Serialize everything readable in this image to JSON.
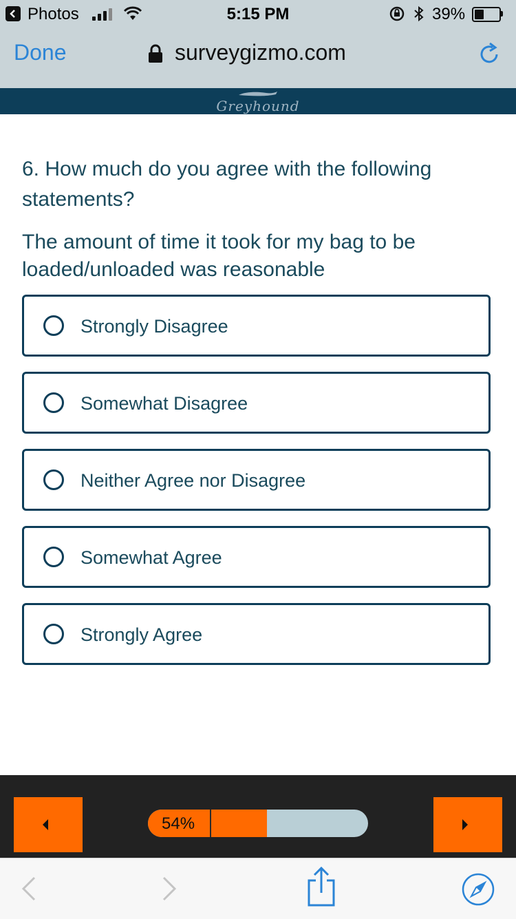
{
  "status_bar": {
    "back_app": "Photos",
    "time": "5:15 PM",
    "battery_percent": "39%",
    "battery_level": 0.39
  },
  "browser": {
    "done_label": "Done",
    "url": "surveygizmo.com"
  },
  "brand": {
    "logo_text": "Greyhound",
    "color": "#0d3e59"
  },
  "survey": {
    "question": "6. How much do you agree with the following statements?",
    "statement": "The amount of time it took for my bag to be loaded/unloaded was reasonable",
    "options": [
      {
        "label": "Strongly Disagree"
      },
      {
        "label": "Somewhat Disagree"
      },
      {
        "label": "Neither Agree nor Disagree"
      },
      {
        "label": "Somewhat Agree"
      },
      {
        "label": "Strongly Agree"
      }
    ]
  },
  "navigation": {
    "progress_label": "54%",
    "progress_value": 0.54,
    "accent_color": "#ff6a00"
  },
  "icons": {
    "back": "chevron-left-icon",
    "forward": "chevron-right-icon",
    "share": "share-icon",
    "compass": "compass-icon",
    "reload": "reload-icon",
    "lock": "lock-icon"
  }
}
